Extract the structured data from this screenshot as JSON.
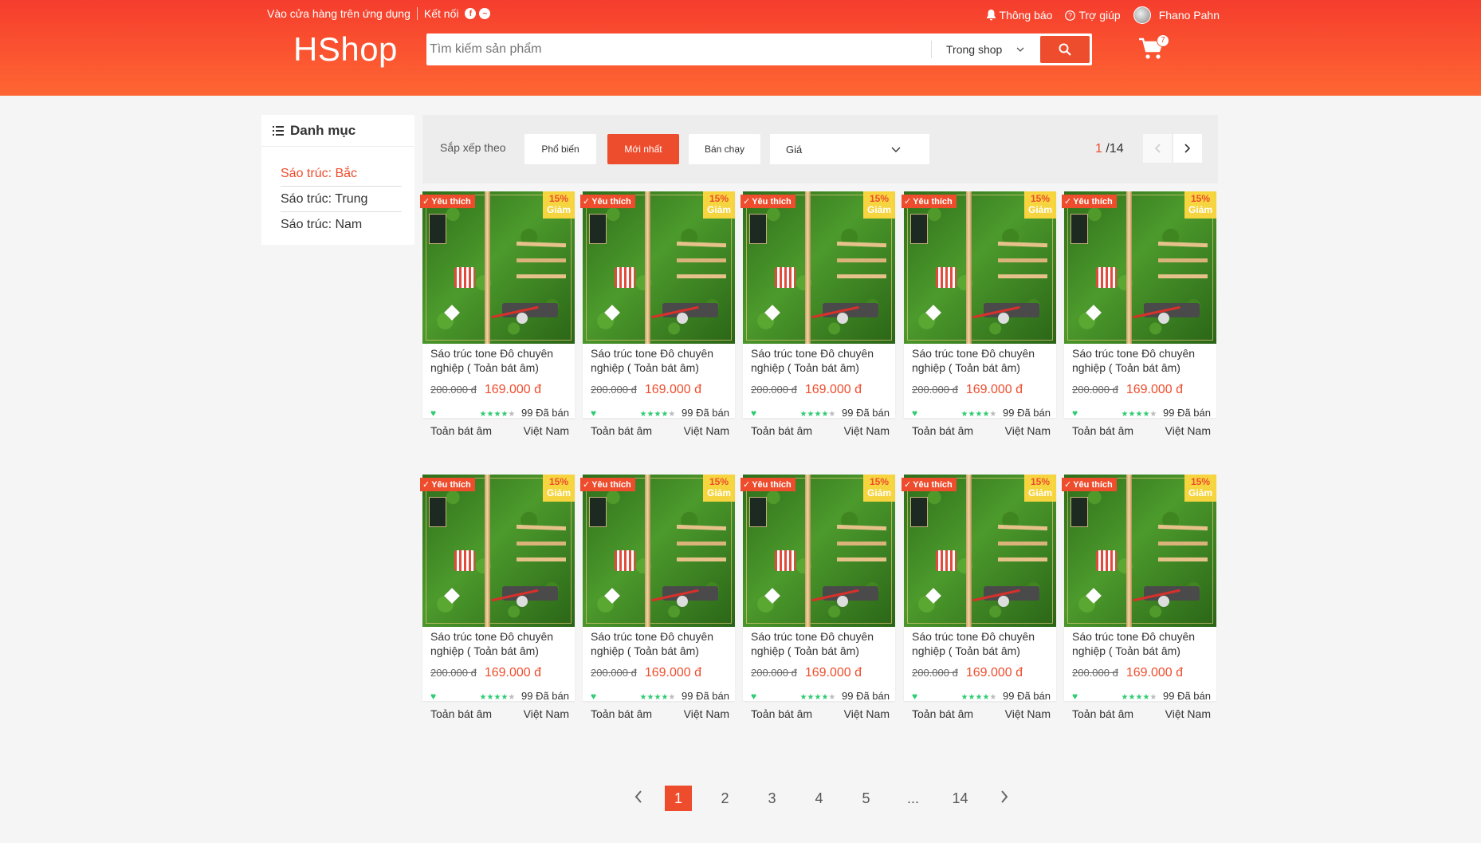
{
  "header": {
    "app_promo": "Vào cửa hàng trên ứng dụng",
    "connect": "Kết nối",
    "notifications": "Thông báo",
    "help": "Trợ giúp",
    "username": "Fhano Pahn",
    "logo": "HShop",
    "search_placeholder": "Tìm kiếm sản phẩm",
    "search_scope": "Trong shop",
    "cart_count": "7"
  },
  "sidebar": {
    "title": "Danh mục",
    "items": [
      {
        "label": "Sáo trúc: Bắc",
        "active": true
      },
      {
        "label": "Sáo trúc: Trung",
        "active": false
      },
      {
        "label": "Sáo trúc: Nam",
        "active": false
      }
    ]
  },
  "sortbar": {
    "label": "Sắp xếp theo",
    "popular": "Phổ biến",
    "newest": "Mới nhất",
    "bestselling": "Bán chạy",
    "price": "Giá",
    "page_current": "1",
    "page_total": "/14"
  },
  "product": {
    "fav_badge": "Yêu thích",
    "discount_pct": "15%",
    "discount_label": "Giảm",
    "name": "Sáo trúc tone Đô chuyên nghiệp ( Toản bát âm)",
    "old_price": "200.000 đ",
    "new_price": "169.000 đ",
    "rating": 4,
    "sold": "99 Đã bán",
    "brand": "Toản bát âm",
    "origin": "Việt Nam"
  },
  "pagination": {
    "pages": [
      "1",
      "2",
      "3",
      "4",
      "5",
      "...",
      "14"
    ],
    "active": "1"
  },
  "colors": {
    "brand": "#ee4d2d",
    "header_gradient_top": "#f53d2d",
    "header_gradient_bottom": "#ff6633",
    "rating_green": "#2ecc71"
  }
}
